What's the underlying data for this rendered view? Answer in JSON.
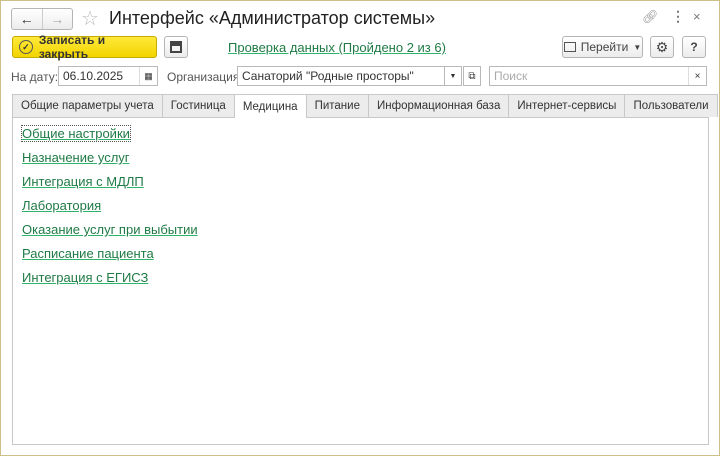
{
  "window": {
    "title": "Интерфейс «Администратор системы»",
    "back_icon": "←",
    "forward_icon": "→"
  },
  "toolbar": {
    "save_close": "Записать и закрыть",
    "check_link": "Проверка данных (Пройдено 2 из 6)",
    "goto": "Перейти",
    "help": "?"
  },
  "filters": {
    "date_label": "На дату:",
    "date_value": "06.10.2025",
    "org_label": "Организация:",
    "org_value": "Санаторий \"Родные просторы\"",
    "search_placeholder": "Поиск"
  },
  "tabs": [
    "Общие параметры учета",
    "Гостиница",
    "Медицина",
    "Питание",
    "Информационная база",
    "Интернет-сервисы",
    "Пользователи"
  ],
  "active_tab": 2,
  "items": [
    "Общие настройки",
    "Назначение услуг",
    "Интеграция с МДЛП",
    "Лаборатория",
    "Оказание услуг при выбытии",
    "Расписание пациента",
    "Интеграция с ЕГИСЗ"
  ],
  "colors": {
    "accent": "#f2d400",
    "link": "#1f7a45"
  }
}
